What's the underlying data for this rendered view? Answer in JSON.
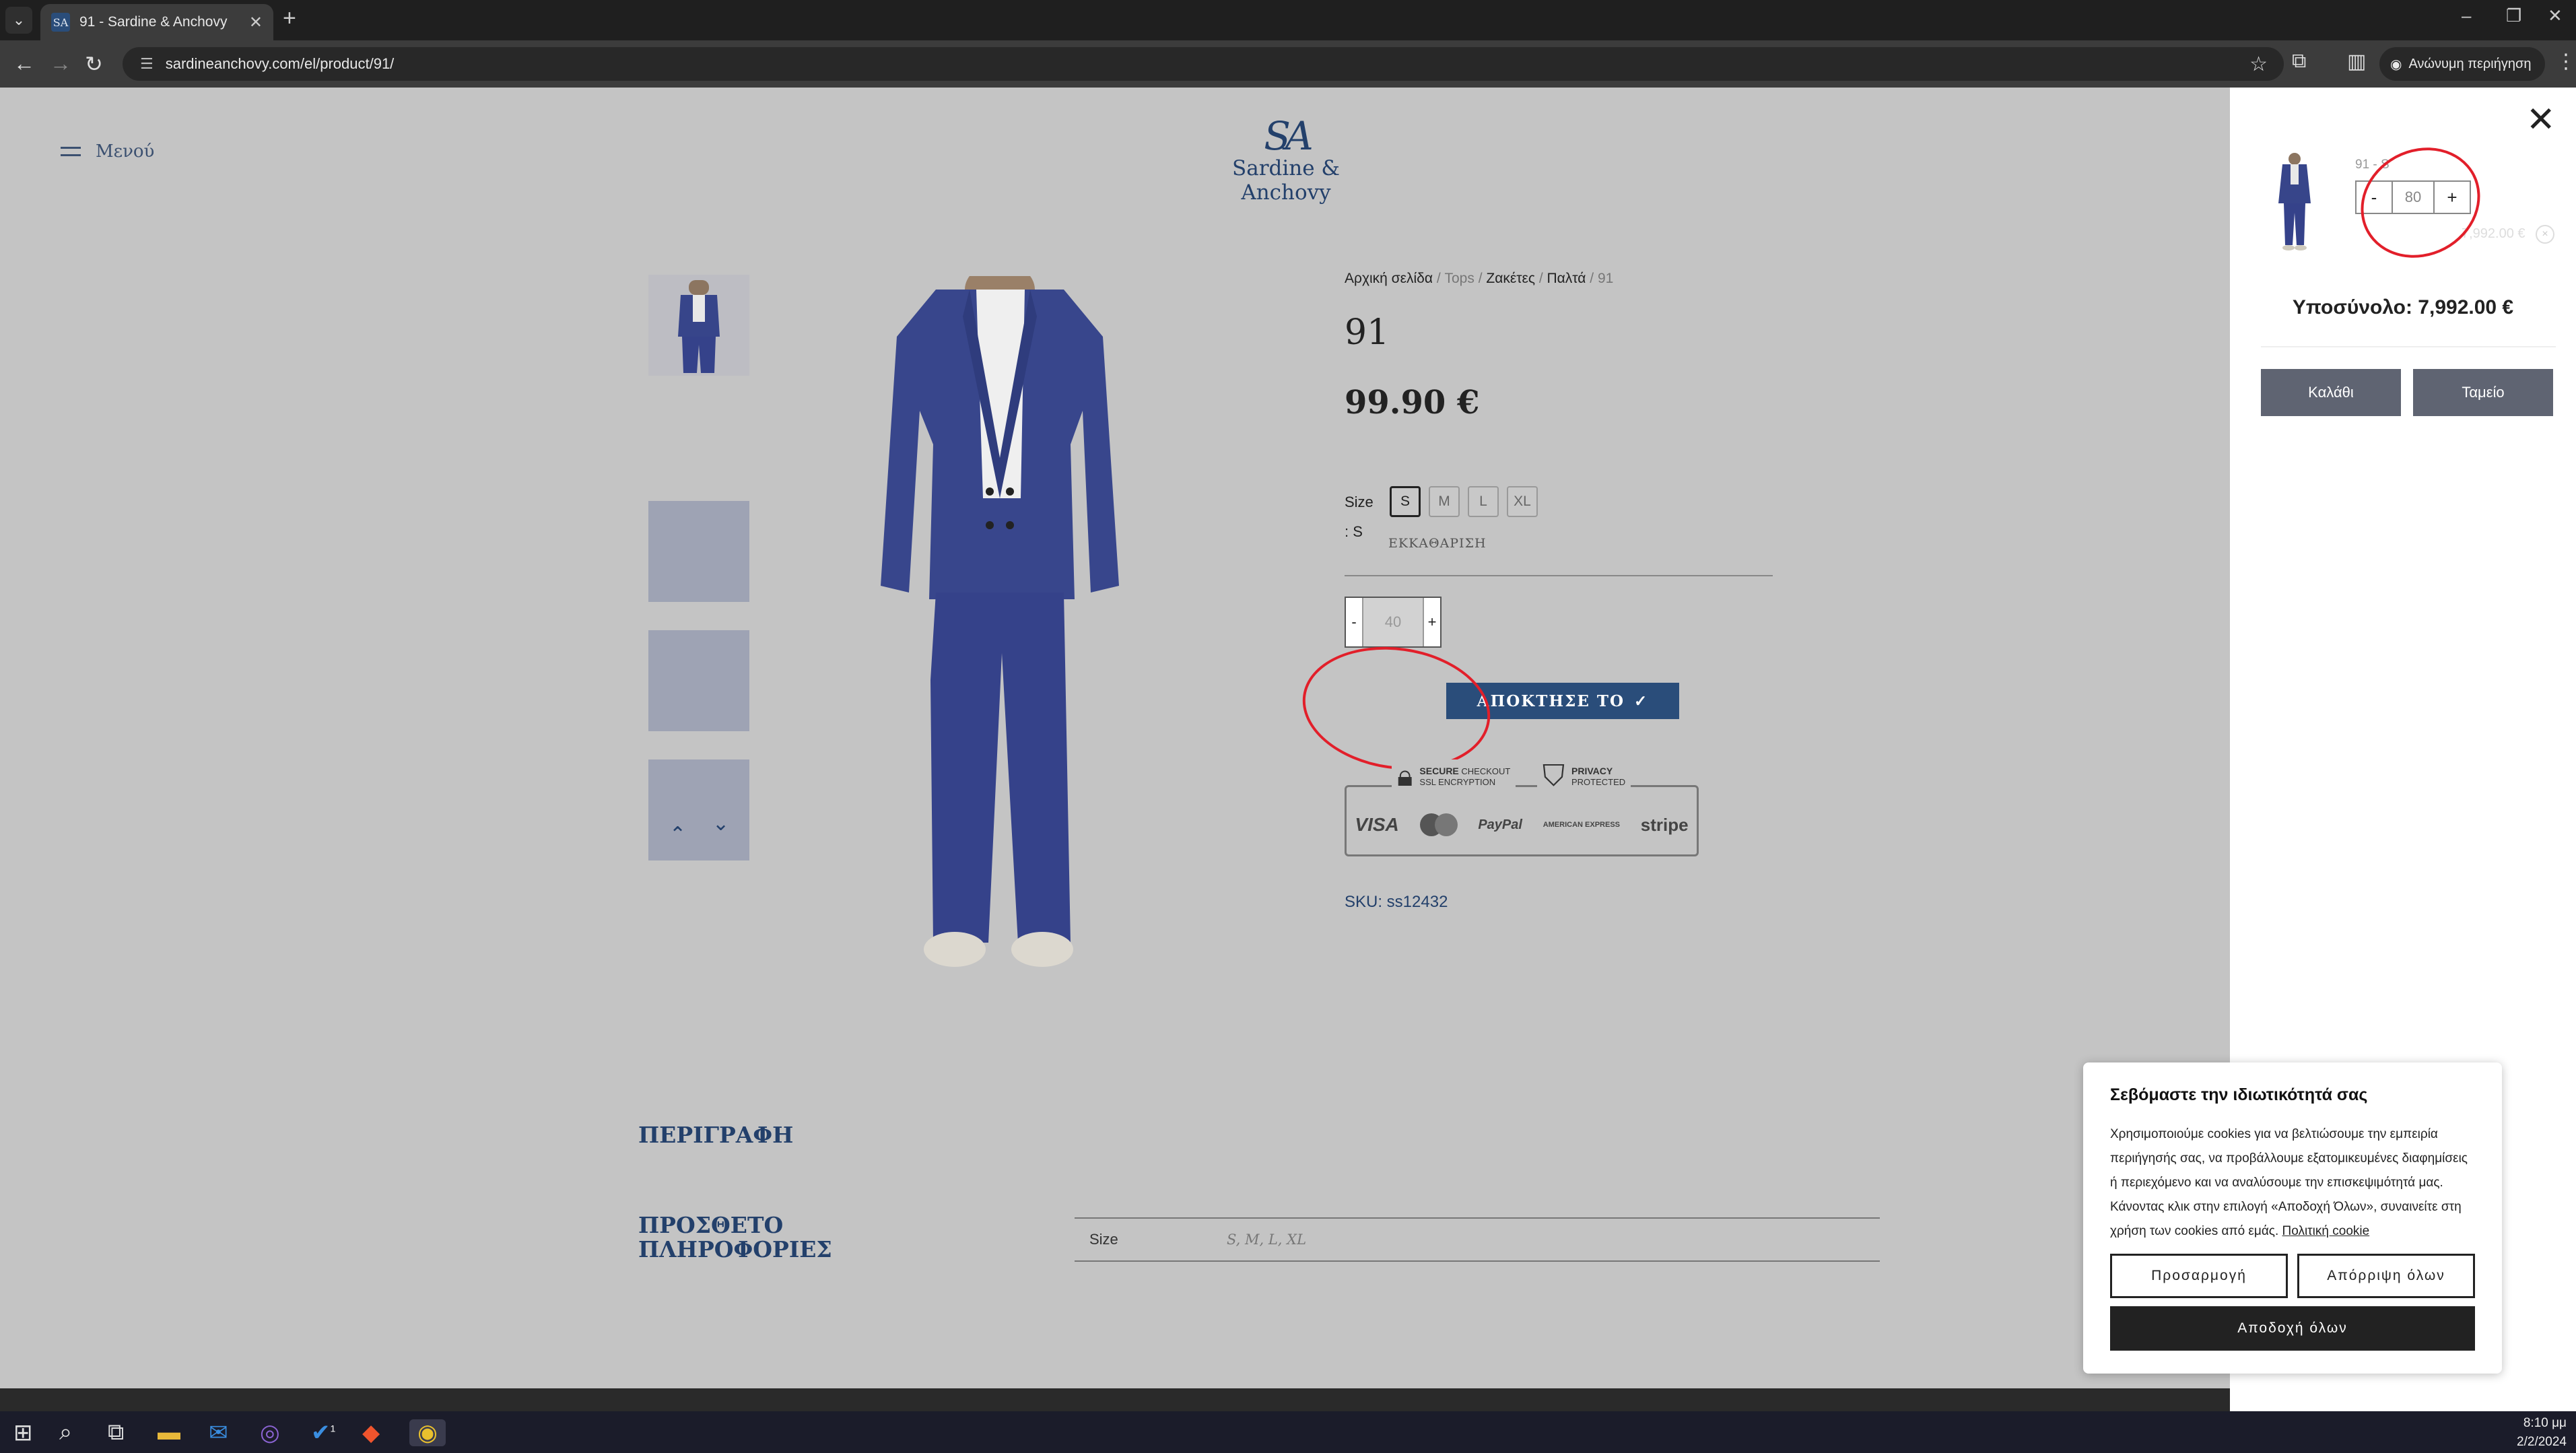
{
  "browser": {
    "tab_title": "91 - Sardine & Anchovy",
    "url": "sardineanchovy.com/el/product/91/",
    "profile_label": "Ανώνυμη περιήγηση"
  },
  "site": {
    "menu_label": "Μενού",
    "logo_monogram": "SA",
    "logo_name": "Sardine & Anchovy"
  },
  "product": {
    "breadcrumb": [
      "Αρχική σελίδα",
      "Tops",
      "Ζακέτες",
      "Παλτά",
      "91"
    ],
    "title": "91",
    "price": "99.90 €",
    "size_label": "Size",
    "size_selected_label": ": S",
    "sizes": [
      "S",
      "M",
      "L",
      "XL"
    ],
    "selected_size": "S",
    "clear_label": "ΕΚΚΑΘΑΡΙΣΗ",
    "quantity": "40",
    "qty_minus": "-",
    "qty_plus": "+",
    "buy_label": "ΑΠΟΚΤΗΣΕ ΤΟ",
    "trust": {
      "secure_title": "SECURE",
      "secure_suffix": "CHECKOUT",
      "secure_sub": "SSL ENCRYPTION",
      "privacy_title": "PRIVACY",
      "privacy_sub": "PROTECTED",
      "payments": [
        "VISA",
        "MasterCard",
        "PayPal",
        "AMERICAN EXPRESS",
        "stripe"
      ]
    },
    "sku": "SKU: ss12432"
  },
  "sections": {
    "description_heading": "ΠΕΡΙΓΡΑΦΗ",
    "extra_heading_1": "ΠΡΟΣΘΕΤΟ",
    "extra_heading_2": "ΠΛΗΡΟΦΟΡΙΕΣ",
    "attributes": [
      {
        "name": "Size",
        "value": "S, M, L, XL"
      }
    ]
  },
  "cart": {
    "item_meta": "91 - S",
    "item_qty": "80",
    "item_price": "7,992.00 €",
    "remove_icon": "×",
    "subtotal": "Υποσύνολο: 7,992.00 €",
    "cart_button": "Καλάθι",
    "checkout_button": "Ταμείο"
  },
  "cookie": {
    "title": "Σεβόμαστε την ιδιωτικότητά σας",
    "body": "Χρησιμοποιούμε cookies για να βελτιώσουμε την εμπειρία περιήγησής σας, να προβάλλουμε εξατομικευμένες διαφημίσεις ή περιεχόμενο και να αναλύσουμε την επισκεψιμότητά μας. Κάνοντας κλικ στην επιλογή «Αποδοχή Όλων», συναινείτε στη χρήση των cookies από εμάς.",
    "policy_link": "Πολιτική cookie",
    "customize": "Προσαρμογή",
    "reject": "Απόρριψη όλων",
    "accept": "Αποδοχή όλων"
  },
  "taskbar": {
    "time": "8:10 μμ",
    "date": "2/2/2024",
    "notification_badge": "1"
  },
  "colors": {
    "brand_navy": "#2a4d7a",
    "annotation_red": "#e21f2a",
    "overlay_grey": "#c4c4c4",
    "drawer_button": "#5f6472"
  },
  "icons": [
    "chevron-down-icon",
    "close-icon",
    "plus-icon",
    "back-icon",
    "forward-icon",
    "reload-icon",
    "site-info-icon",
    "star-icon",
    "extensions-icon",
    "sidebar-icon",
    "incognito-icon",
    "kebab-icon",
    "hamburger-icon",
    "check-icon",
    "lock-icon",
    "shield-check-icon",
    "chevron-up-icon",
    "windows-icon",
    "search-icon",
    "task-view-icon",
    "folder-icon",
    "mail-icon",
    "viber-icon",
    "todo-icon",
    "brave-icon",
    "chrome-icon"
  ]
}
